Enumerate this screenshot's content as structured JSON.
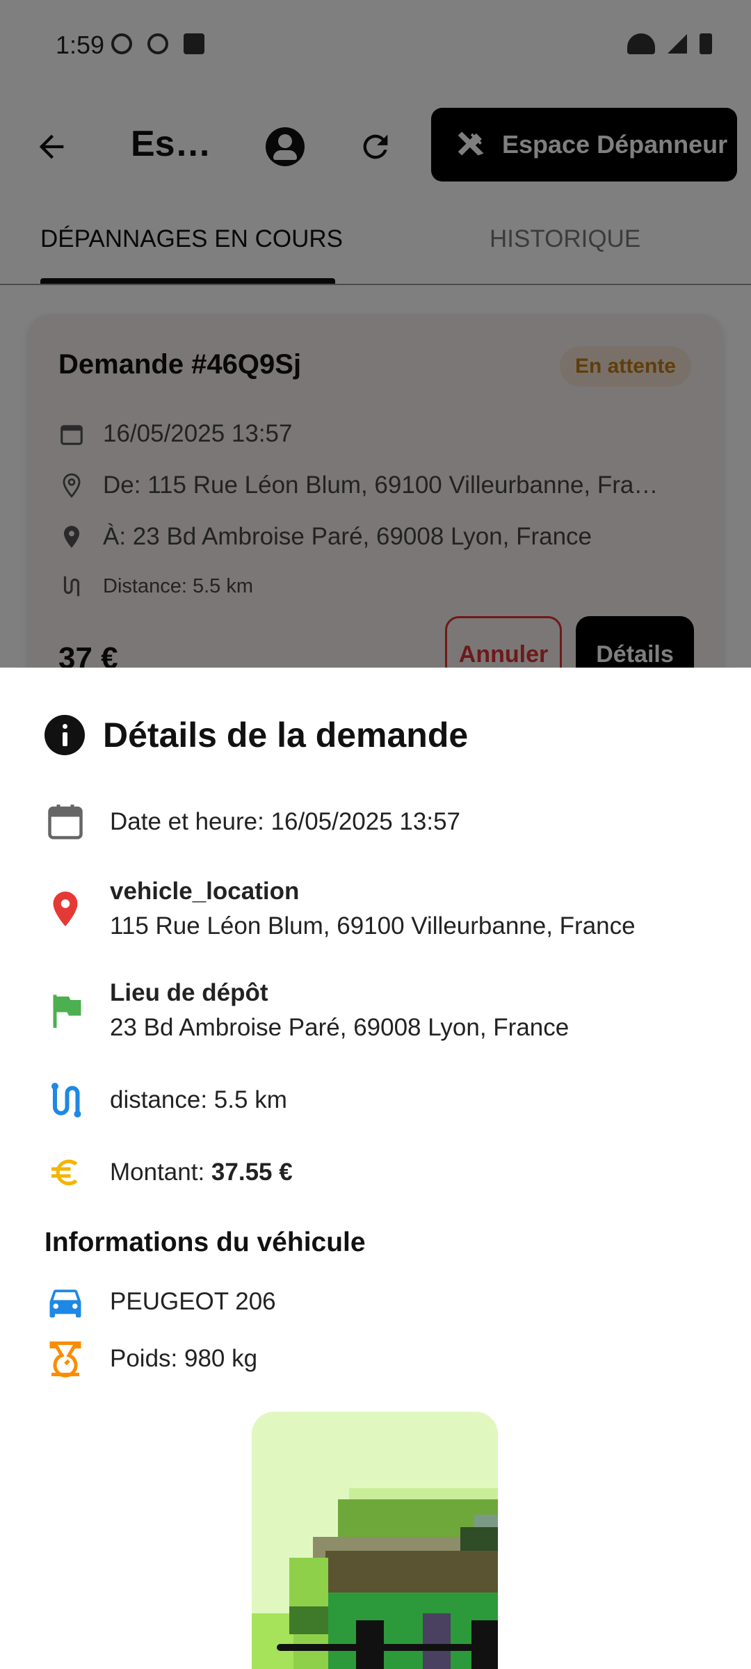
{
  "status_bar": {
    "time": "1:59"
  },
  "app_bar": {
    "title": "Es…",
    "espace_button": "Espace Dépanneur"
  },
  "tabs": [
    {
      "label": "DÉPANNAGES EN COURS",
      "selected": true
    },
    {
      "label": "HISTORIQUE",
      "selected": false
    }
  ],
  "card": {
    "title": "Demande #46Q9Sj",
    "status": "En attente",
    "datetime": "16/05/2025 13:57",
    "from": "De: 115 Rue Léon Blum, 69100 Villeurbanne, Fra…",
    "to": "À: 23 Bd Ambroise Paré, 69008 Lyon, France",
    "distance": "Distance: 5.5 km",
    "price": "37 €",
    "cancel_label": "Annuler",
    "details_label": "Détails"
  },
  "sheet": {
    "title": "Détails de la demande",
    "datetime_label": "Date et heure: 16/05/2025 13:57",
    "location_label": "vehicle_location",
    "location_value": "115 Rue Léon Blum, 69100 Villeurbanne, France",
    "depot_label": "Lieu de dépôt",
    "depot_value": "23 Bd Ambroise Paré, 69008 Lyon, France",
    "distance": "distance: 5.5 km",
    "amount_label": "Montant: ",
    "amount_value": "37.55 €",
    "vehicle_section": "Informations du véhicule",
    "vehicle_model": "PEUGEOT 206",
    "weight": "Poids: 980 kg"
  },
  "colors": {
    "status_pill_text": "#c07a14",
    "cancel": "#dd3333",
    "pin_red": "#e53935",
    "flag_green": "#4caf50",
    "route_blue": "#1e88e5",
    "euro_amber": "#f4b400",
    "car_blue": "#1e88e5",
    "scale_orange": "#fb8c00"
  }
}
